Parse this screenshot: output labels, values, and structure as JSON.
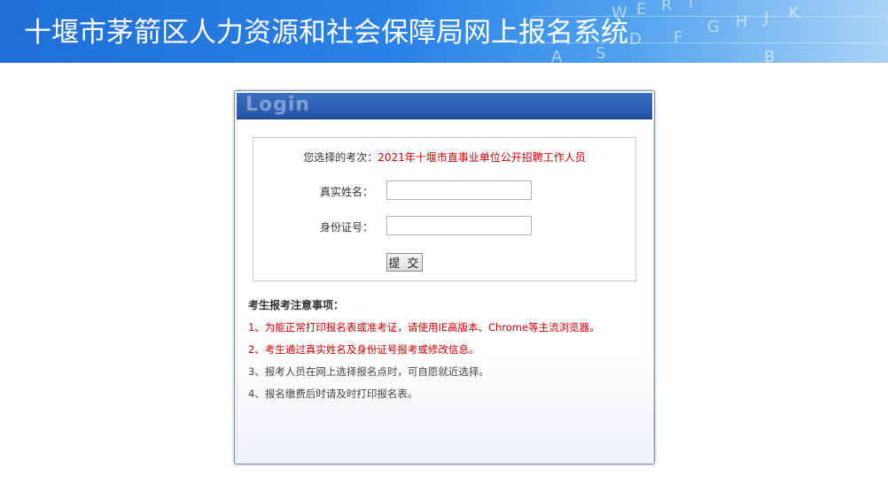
{
  "header": {
    "title": "十堰市茅箭区人力资源和社会保障局网上报名系统",
    "keyboard_letters": [
      "W",
      "E",
      "R",
      "T",
      "G",
      "H",
      "J",
      "K",
      "D",
      "F",
      "S",
      "A",
      "B"
    ]
  },
  "login": {
    "panel_title": "Login",
    "exam_prefix": "您选择的考次：",
    "exam_name": "2021年十堰市直事业单位公开招聘工作人员",
    "name_label": "真实姓名：",
    "name_value": "",
    "id_label": "身份证号：",
    "id_value": "",
    "submit_label": "提 交"
  },
  "notes": {
    "title": "考生报考注意事项：",
    "items": [
      "1、为能正常打印报名表或准考证，请使用IE高版本、Chrome等主流浏览器。",
      "2、考生通过真实姓名及身份证号报考或修改信息。",
      "3、报考人员在网上选择报名点时，可自愿就近选择。",
      "4、报名缴费后时请及时打印报名表。"
    ]
  },
  "colors": {
    "banner": "#2b82e6",
    "panel_header": "#2f61b4",
    "warning_red": "#cc0000"
  }
}
